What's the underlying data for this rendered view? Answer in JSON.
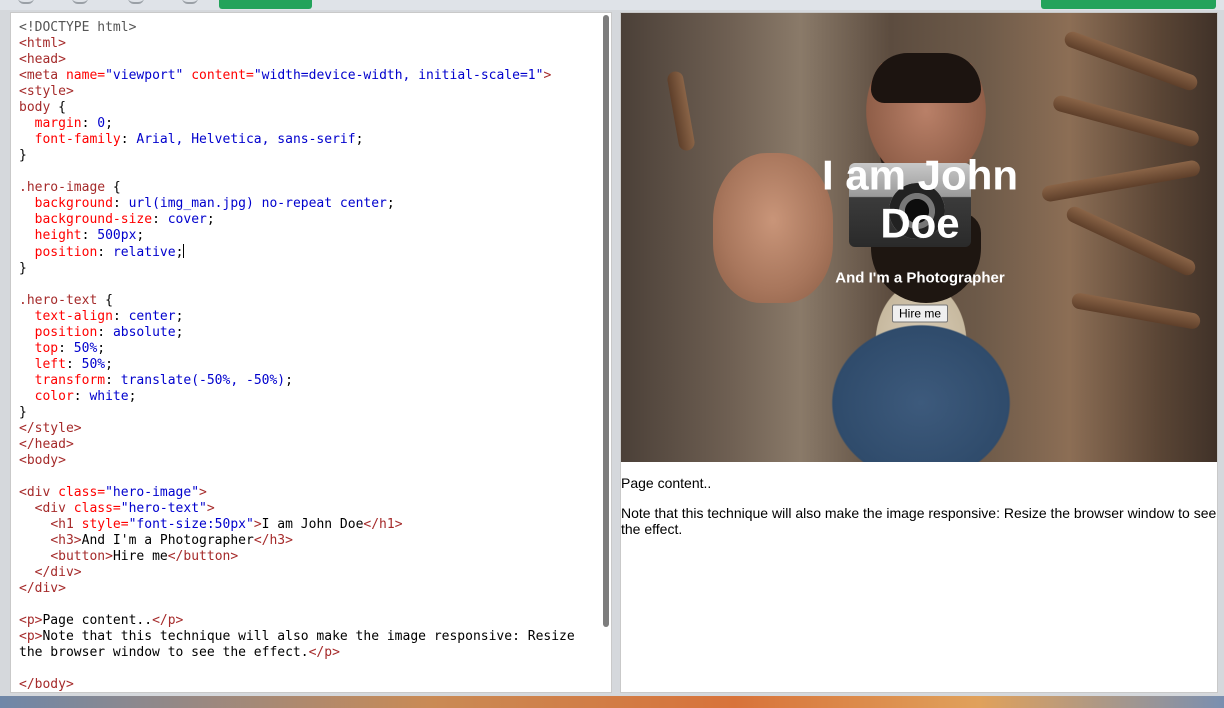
{
  "toolbar": {
    "run_button_color": "#23a35b"
  },
  "editor": {
    "lines": {
      "l1": "<!DOCTYPE html>",
      "css_body_margin": "margin",
      "hero_image_selector": ".hero-image",
      "hero_text_selector": ".hero-text"
    },
    "code_segments": {
      "doctype": "<!DOCTYPE html>",
      "html_open": "<html>",
      "head_open": "<head>",
      "meta_open": "<meta ",
      "meta_name_attr": "name=",
      "meta_name_val": "\"viewport\"",
      "meta_content_attr": "content=",
      "meta_content_val": "\"width=device-width, initial-scale=1\"",
      "meta_close": ">",
      "style_open": "<style>",
      "body_sel": "body",
      "brace_open": " {",
      "margin_prop": "margin",
      "margin_val": "0",
      "font_prop": "font-family",
      "font_val": "Arial, Helvetica, sans-serif",
      "brace_close": "}",
      "hero_image_sel": ".hero-image",
      "bg_prop": "background",
      "bg_val": "url(img_man.jpg) no-repeat center",
      "bgsize_prop": "background-size",
      "bgsize_val": "cover",
      "height_prop": "height",
      "height_val": "500px",
      "pos_prop": "position",
      "pos_rel_val": "relative",
      "hero_text_sel": ".hero-text",
      "ta_prop": "text-align",
      "ta_val": "center",
      "pos_abs_val": "absolute",
      "top_prop": "top",
      "top_val": "50%",
      "left_prop": "left",
      "left_val": "50%",
      "transform_prop": "transform",
      "transform_val": "translate(-50%, -50%)",
      "color_prop": "color",
      "color_val": "white",
      "style_close": "</style>",
      "head_close": "</head>",
      "body_open": "<body>",
      "div_open": "<div ",
      "class_attr": "class=",
      "class_hero_image_val": "\"hero-image\"",
      "class_hero_text_val": "\"hero-text\"",
      "gt": ">",
      "h1_open": "<h1 ",
      "style_attr": "style=",
      "h1_style_val": "\"font-size:50px\"",
      "h1_text": "I am John Doe",
      "h1_close": "</h1>",
      "h3_open": "<h3>",
      "h3_text": "And I'm a Photographer",
      "h3_close": "</h3>",
      "button_open": "<button>",
      "button_text": "Hire me",
      "button_close": "</button>",
      "div_close": "</div>",
      "p_open": "<p>",
      "p1_text": "Page content..",
      "p_close": "</p>",
      "p2_text_a": "Note that this technique will also make the image responsive: Resize",
      "p2_text_b": "the browser window to see the effect.",
      "body_close": "</body>"
    }
  },
  "preview": {
    "hero_title": "I am John Doe",
    "hero_subtitle": "And I'm a Photographer",
    "hero_button": "Hire me",
    "paragraph_1": "Page content..",
    "paragraph_2": "Note that this technique will also make the image responsive: Resize the browser window to see the effect."
  }
}
